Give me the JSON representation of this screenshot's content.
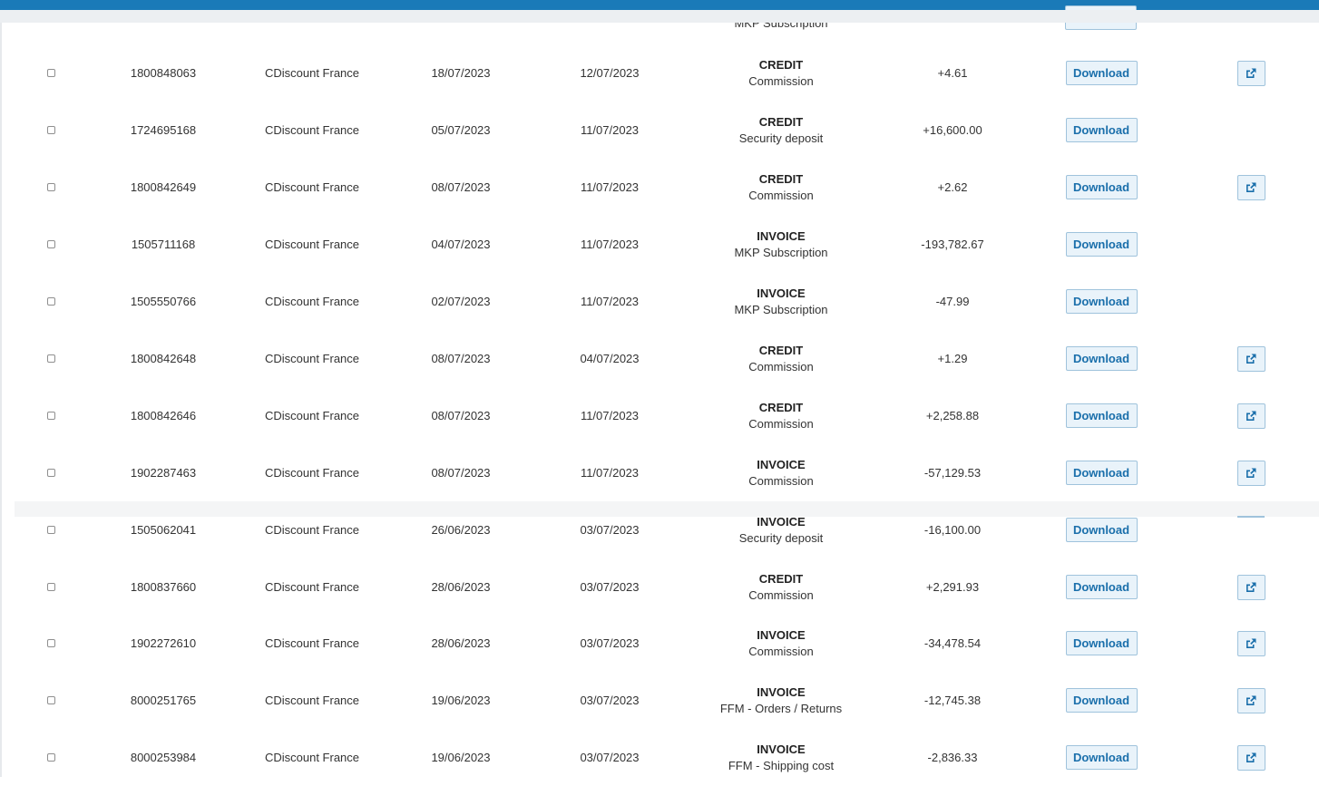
{
  "table": {
    "partial_top_row": {
      "type_sub": "MKP Subscription"
    },
    "download_label": "Download",
    "rows": [
      {
        "number": "1800848063",
        "seller": "CDiscount France",
        "date1": "18/07/2023",
        "date2": "12/07/2023",
        "type": "CREDIT",
        "category": "Commission",
        "amount": "+4.61",
        "has_link": true
      },
      {
        "number": "1724695168",
        "seller": "CDiscount France",
        "date1": "05/07/2023",
        "date2": "11/07/2023",
        "type": "CREDIT",
        "category": "Security deposit",
        "amount": "+16,600.00",
        "has_link": false
      },
      {
        "number": "1800842649",
        "seller": "CDiscount France",
        "date1": "08/07/2023",
        "date2": "11/07/2023",
        "type": "CREDIT",
        "category": "Commission",
        "amount": "+2.62",
        "has_link": true
      },
      {
        "number": "1505711168",
        "seller": "CDiscount France",
        "date1": "04/07/2023",
        "date2": "11/07/2023",
        "type": "INVOICE",
        "category": "MKP Subscription",
        "amount": "-193,782.67",
        "has_link": false
      },
      {
        "number": "1505550766",
        "seller": "CDiscount France",
        "date1": "02/07/2023",
        "date2": "11/07/2023",
        "type": "INVOICE",
        "category": "MKP Subscription",
        "amount": "-47.99",
        "has_link": false
      },
      {
        "number": "1800842648",
        "seller": "CDiscount France",
        "date1": "08/07/2023",
        "date2": "04/07/2023",
        "type": "CREDIT",
        "category": "Commission",
        "amount": "+1.29",
        "has_link": true
      },
      {
        "number": "1800842646",
        "seller": "CDiscount France",
        "date1": "08/07/2023",
        "date2": "11/07/2023",
        "type": "CREDIT",
        "category": "Commission",
        "amount": "+2,258.88",
        "has_link": true
      },
      {
        "number": "1902287463",
        "seller": "CDiscount France",
        "date1": "08/07/2023",
        "date2": "11/07/2023",
        "type": "INVOICE",
        "category": "Commission",
        "amount": "-57,129.53",
        "has_link": true
      },
      {
        "number": "1505062041",
        "seller": "CDiscount France",
        "date1": "26/06/2023",
        "date2": "03/07/2023",
        "type": "INVOICE",
        "category": "Security deposit",
        "amount": "-16,100.00",
        "has_link": false
      },
      {
        "number": "1800837660",
        "seller": "CDiscount France",
        "date1": "28/06/2023",
        "date2": "03/07/2023",
        "type": "CREDIT",
        "category": "Commission",
        "amount": "+2,291.93",
        "has_link": true
      },
      {
        "number": "1902272610",
        "seller": "CDiscount France",
        "date1": "28/06/2023",
        "date2": "03/07/2023",
        "type": "INVOICE",
        "category": "Commission",
        "amount": "-34,478.54",
        "has_link": true
      },
      {
        "number": "8000251765",
        "seller": "CDiscount France",
        "date1": "19/06/2023",
        "date2": "03/07/2023",
        "type": "INVOICE",
        "category": "FFM - Orders / Returns",
        "amount": "-12,745.38",
        "has_link": true
      },
      {
        "number": "8000253984",
        "seller": "CDiscount France",
        "date1": "19/06/2023",
        "date2": "03/07/2023",
        "type": "INVOICE",
        "category": "FFM - Shipping cost",
        "amount": "-2,836.33",
        "has_link": true
      }
    ]
  },
  "colors": {
    "top_bar": "#1a7ab8",
    "button_text": "#1a6fab",
    "button_bg": "#e9f3fa",
    "button_border": "#9fc3dc"
  },
  "icons": {
    "external_link": "external-link-icon"
  }
}
